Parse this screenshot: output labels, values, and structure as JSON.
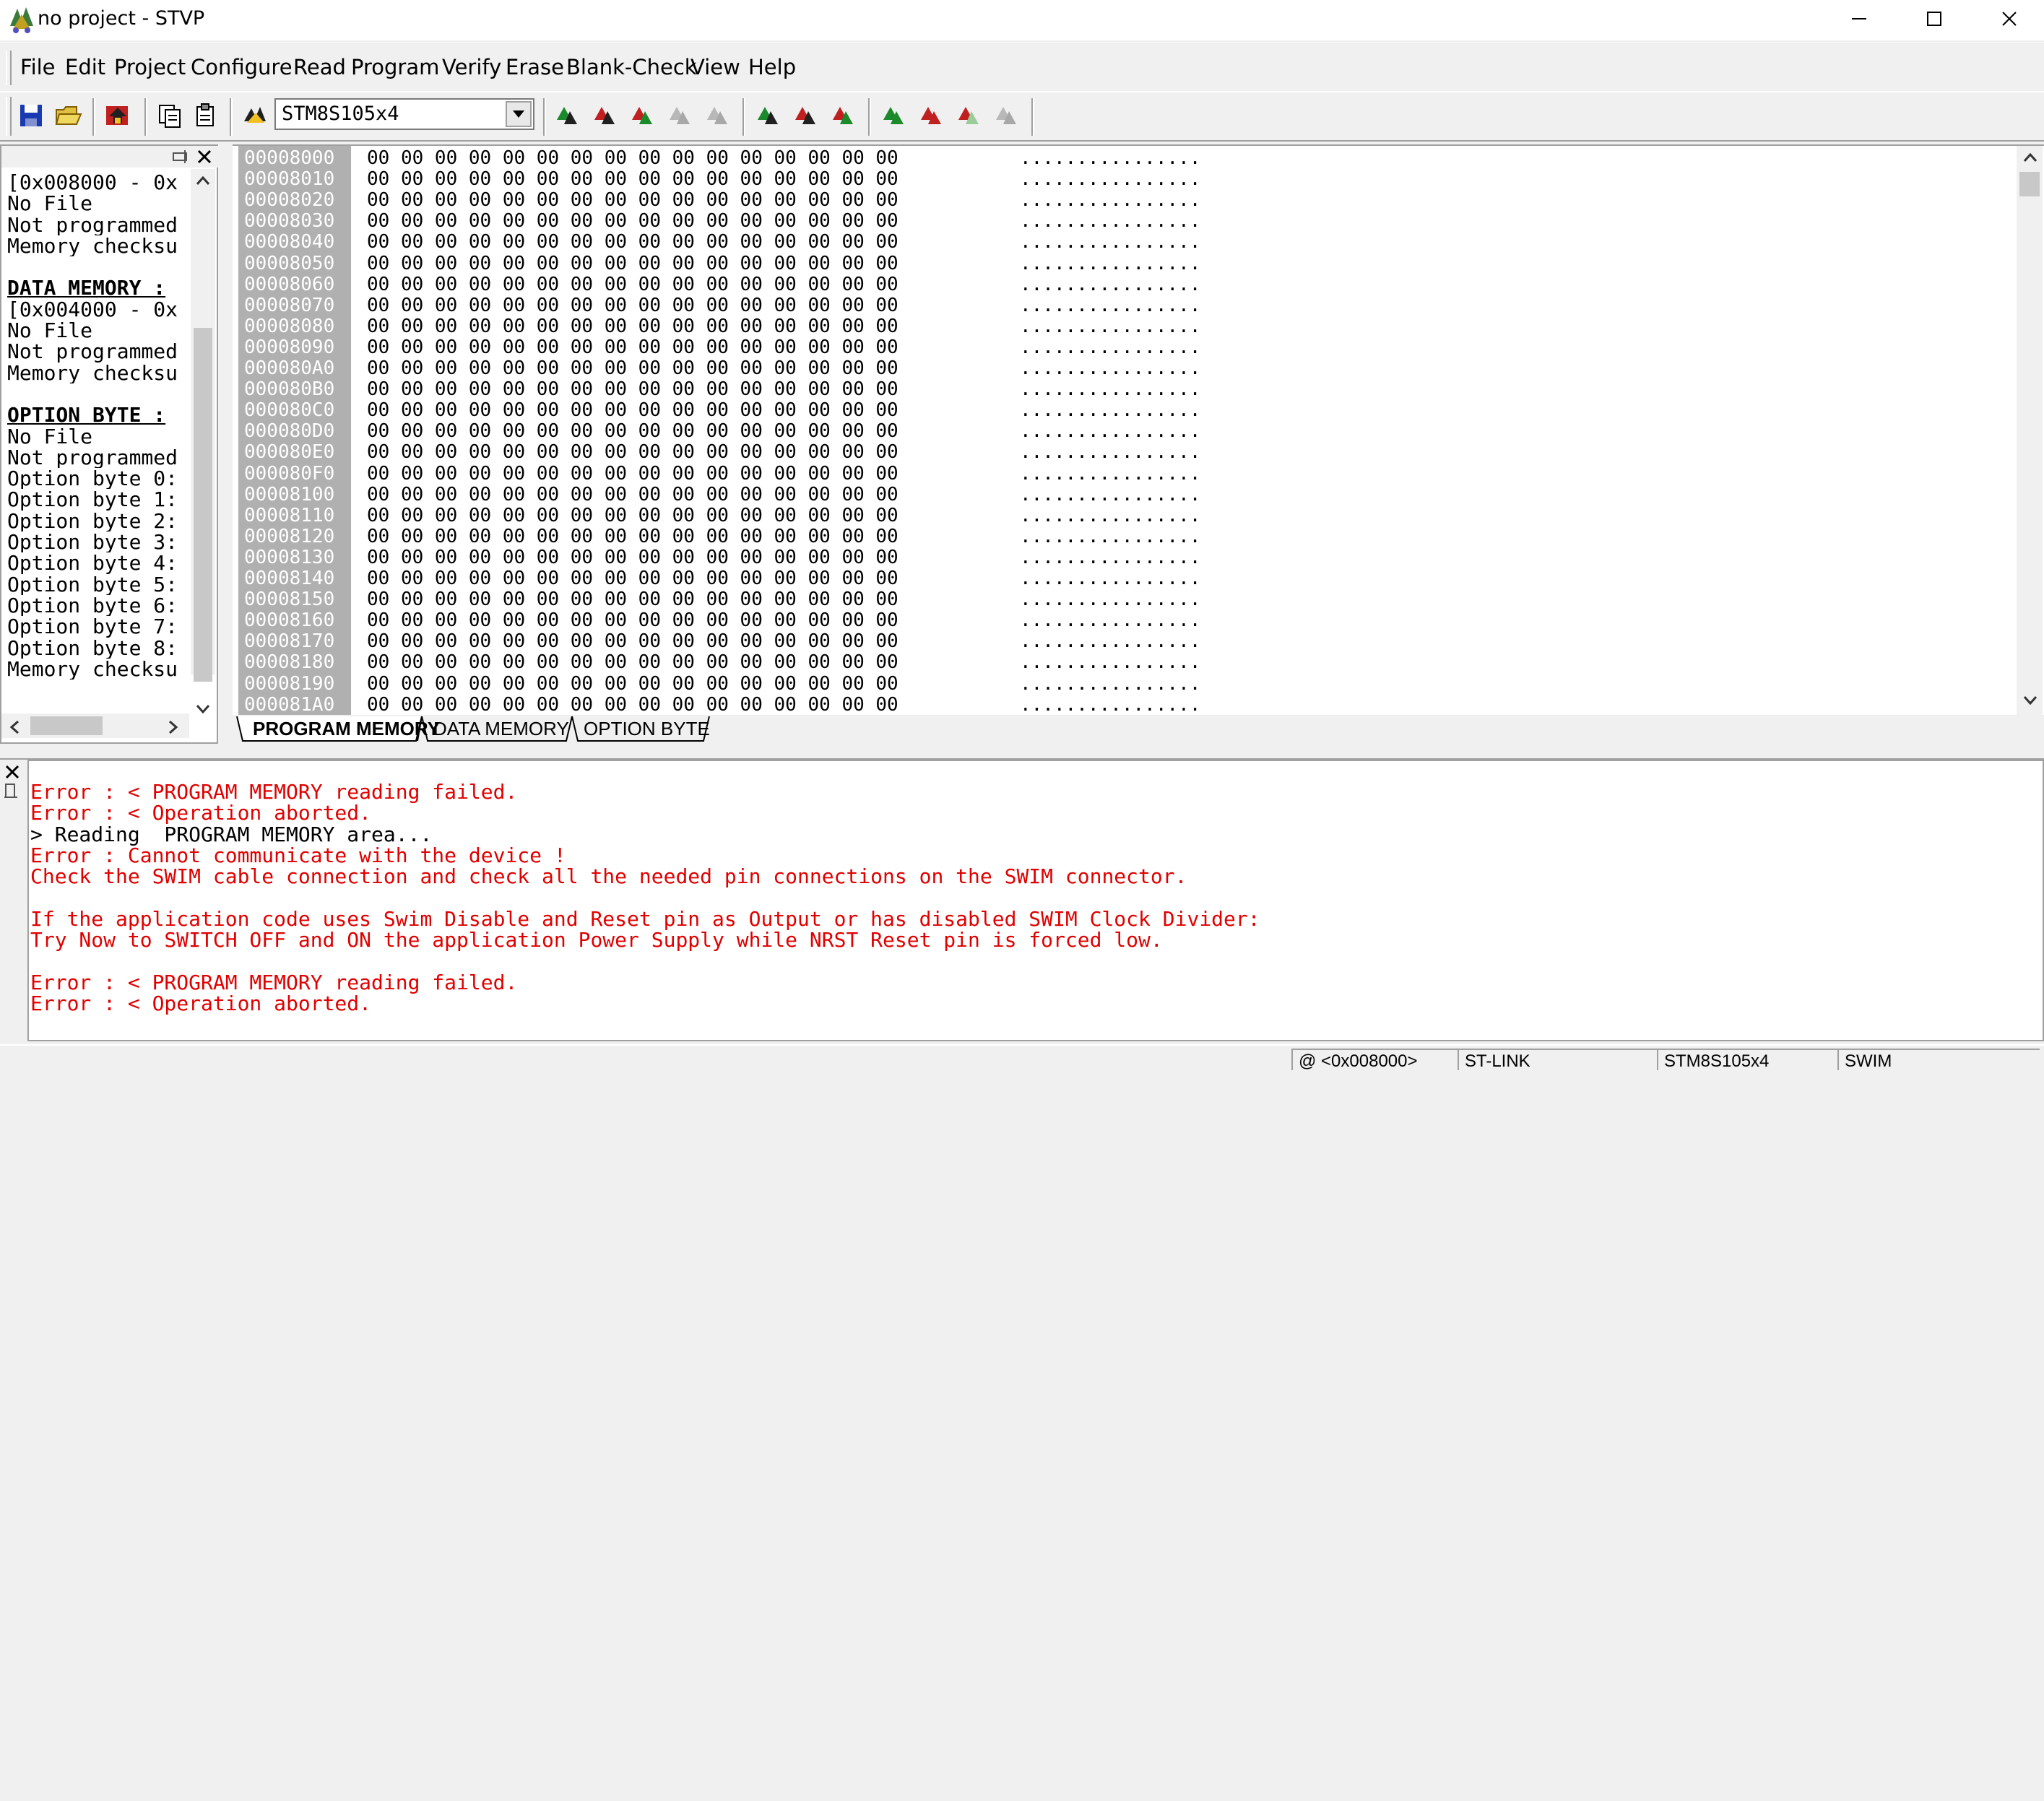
{
  "window": {
    "title": "no project - STVP",
    "minimize_glyph": "—",
    "maximize_glyph": "☐",
    "close_glyph": "✕"
  },
  "menu": [
    {
      "label": "File"
    },
    {
      "label": "Edit"
    },
    {
      "label": "Project"
    },
    {
      "label": "Configure"
    },
    {
      "label": "Read"
    },
    {
      "label": "Program"
    },
    {
      "label": "Verify"
    },
    {
      "label": "Erase"
    },
    {
      "label": "Blank-Check"
    },
    {
      "label": "View"
    },
    {
      "label": "Help"
    }
  ],
  "toolbar": {
    "device": "STM8S105x4",
    "icons": [
      "save-icon",
      "open-icon",
      "project-icon",
      "copy-icon",
      "paste-icon",
      "device-icon",
      "read-icon",
      "read-all-icon",
      "read-active-icon",
      "read-disabled-icon",
      "read-disabled2-icon",
      "program-icon",
      "program-all-icon",
      "program-active-icon",
      "verify-icon",
      "verify-all-icon",
      "verify-active-icon",
      "verify-disabled-icon"
    ]
  },
  "left_panel": {
    "lines": [
      {
        "text": "[0x008000 - 0x",
        "head": false
      },
      {
        "text": "No File",
        "head": false
      },
      {
        "text": "Not programmed",
        "head": false
      },
      {
        "text": "Memory checksu",
        "head": false
      },
      {
        "text": "",
        "head": false
      },
      {
        "text": "DATA MEMORY :",
        "head": true
      },
      {
        "text": "[0x004000 - 0x",
        "head": false
      },
      {
        "text": "No File",
        "head": false
      },
      {
        "text": "Not programmed",
        "head": false
      },
      {
        "text": "Memory checksu",
        "head": false
      },
      {
        "text": "",
        "head": false
      },
      {
        "text": "OPTION BYTE :",
        "head": true
      },
      {
        "text": "No File",
        "head": false
      },
      {
        "text": "Not programmed",
        "head": false
      },
      {
        "text": "Option byte 0:",
        "head": false
      },
      {
        "text": "Option byte 1:",
        "head": false
      },
      {
        "text": "Option byte 2:",
        "head": false
      },
      {
        "text": "Option byte 3:",
        "head": false
      },
      {
        "text": "Option byte 4:",
        "head": false
      },
      {
        "text": "Option byte 5:",
        "head": false
      },
      {
        "text": "Option byte 6:",
        "head": false
      },
      {
        "text": "Option byte 7:",
        "head": false
      },
      {
        "text": "Option byte 8:",
        "head": false
      },
      {
        "text": "Memory checksu",
        "head": false
      }
    ]
  },
  "hex": {
    "addresses": [
      "00008000",
      "00008010",
      "00008020",
      "00008030",
      "00008040",
      "00008050",
      "00008060",
      "00008070",
      "00008080",
      "00008090",
      "000080A0",
      "000080B0",
      "000080C0",
      "000080D0",
      "000080E0",
      "000080F0",
      "00008100",
      "00008110",
      "00008120",
      "00008130",
      "00008140",
      "00008150",
      "00008160",
      "00008170",
      "00008180",
      "00008190",
      "000081A0"
    ],
    "bytes": "00 00 00 00 00 00 00 00 00 00 00 00 00 00 00 00",
    "ascii": "................"
  },
  "tabs": [
    {
      "label": "PROGRAM MEMORY",
      "active": true
    },
    {
      "label": "DATA MEMORY",
      "active": false
    },
    {
      "label": "OPTION BYTE",
      "active": false
    }
  ],
  "log": [
    {
      "text": "Error : < PROGRAM MEMORY reading failed.",
      "color": "#e00000"
    },
    {
      "text": "Error : < Operation aborted.",
      "color": "#e00000"
    },
    {
      "text": "> Reading  PROGRAM MEMORY area...",
      "color": "#000000"
    },
    {
      "text": "Error : Cannot communicate with the device !",
      "color": "#e00000"
    },
    {
      "text": "Check the SWIM cable connection and check all the needed pin connections on the SWIM connector.",
      "color": "#e00000"
    },
    {
      "text": "",
      "color": "#e00000"
    },
    {
      "text": "If the application code uses Swim Disable and Reset pin as Output or has disabled SWIM Clock Divider:",
      "color": "#e00000"
    },
    {
      "text": "Try Now to SWITCH OFF and ON the application Power Supply while NRST Reset pin is forced low.",
      "color": "#e00000"
    },
    {
      "text": "",
      "color": "#e00000"
    },
    {
      "text": "Error : < PROGRAM MEMORY reading failed.",
      "color": "#e00000"
    },
    {
      "text": "Error : < Operation aborted.",
      "color": "#e00000"
    }
  ],
  "status": {
    "address": "@ <0x008000>",
    "programmer": "ST-LINK",
    "device": "STM8S105x4",
    "protocol": "SWIM"
  },
  "colors": {
    "error": "#e00000",
    "address_bg": "#b0b0b0"
  }
}
